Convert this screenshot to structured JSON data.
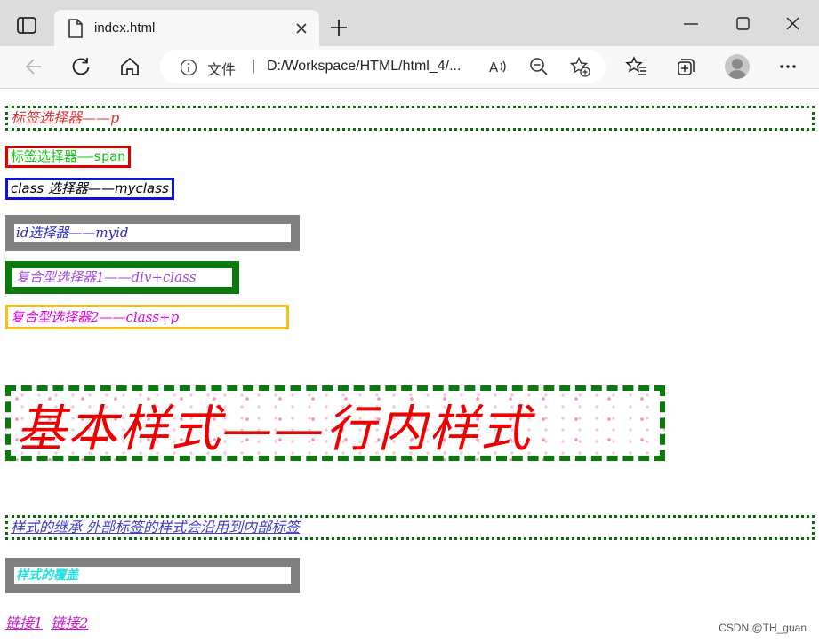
{
  "browser": {
    "tab_title": "index.html",
    "address_prefix": "文件",
    "address_separator": "|",
    "url": "D:/Workspace/HTML/html_4/..."
  },
  "content": {
    "p_selector": "标签选择器——p",
    "span_selector": "标签选择器——span",
    "class_selector": "class 选择器——myclass",
    "id_selector": "id选择器——myid",
    "compound_1": "复合型选择器1——div+class",
    "compound_2": "复合型选择器2——class+p",
    "inline_style": "基本样式——行内样式",
    "inheritance": "样式的继承 外部标签的样式会沿用到内部标签",
    "override": "样式的覆盖",
    "link_1": "链接1",
    "link_2": "链接2"
  },
  "watermark": "CSDN @TH_guan",
  "colors": {
    "p_text": "#e23232",
    "span_text": "#17c517",
    "span_border": "#e00000",
    "class_border": "#1010dd",
    "id_text": "#2a2acc",
    "id_border": "#808080",
    "compound1_border": "#0a7a0a",
    "compound1_text": "#9a4adf",
    "compound2_border": "#f2c21a",
    "compound2_text": "#e000e0",
    "inline_text": "#ee0000",
    "inherit_text": "#3a3acc",
    "override_text": "#22e0e0",
    "links_text": "#d010d0"
  },
  "icons": [
    "sidebar-toggle-icon",
    "file-icon",
    "close-icon",
    "plus-icon",
    "minimize-icon",
    "maximize-icon",
    "window-close-icon",
    "back-icon",
    "refresh-icon",
    "home-icon",
    "info-icon",
    "read-aloud-icon",
    "zoom-out-icon",
    "add-favorite-icon",
    "favorites-icon",
    "collections-icon",
    "profile-icon",
    "more-icon"
  ]
}
